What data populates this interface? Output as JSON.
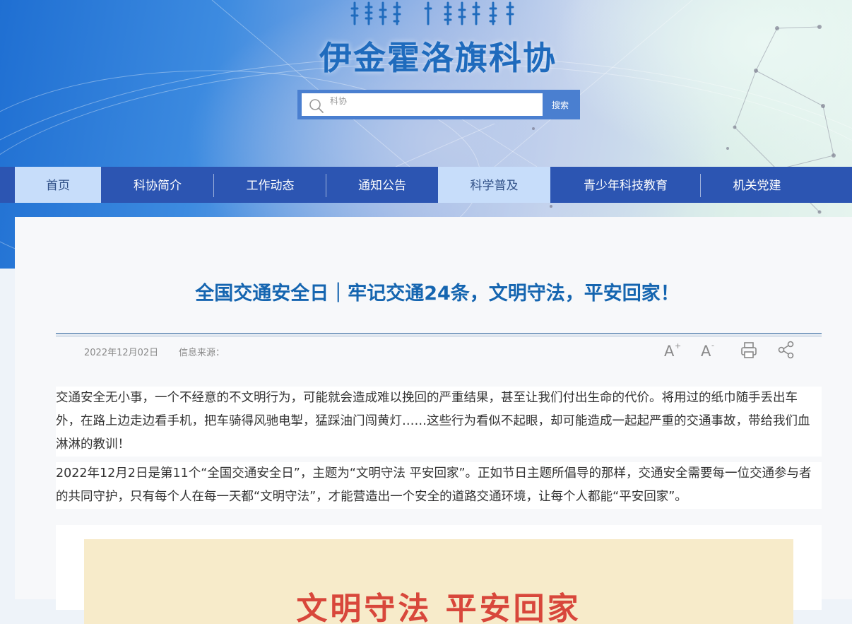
{
  "header": {
    "mongolian_title_decor": "mongolian-script-title",
    "site_title": "伊金霍洛旗科协",
    "search": {
      "placeholder": "科协",
      "button_label": "搜索",
      "icon": "search-icon"
    }
  },
  "nav": {
    "items": [
      {
        "label": "首页",
        "active": true
      },
      {
        "label": "科协简介",
        "active": false
      },
      {
        "label": "工作动态",
        "active": false
      },
      {
        "label": "通知公告",
        "active": false
      },
      {
        "label": "科学普及",
        "active": true
      },
      {
        "label": "青少年科技教育",
        "active": false
      },
      {
        "label": "机关党建",
        "active": false
      }
    ]
  },
  "article": {
    "title": "全国交通安全日｜牢记交通24条，文明守法，平安回家！",
    "date": "2022年12月02日",
    "source_label": "信息来源：",
    "tools": [
      {
        "name": "font-increase-icon",
        "label": "A+"
      },
      {
        "name": "font-decrease-icon",
        "label": "A-"
      },
      {
        "name": "print-icon",
        "label": "print"
      },
      {
        "name": "share-icon",
        "label": "share"
      }
    ],
    "paragraphs": [
      "交通安全无小事，一个不经意的不文明行为，可能就会造成难以挽回的严重结果，甚至让我们付出生命的代价。将用过的纸巾随手丢出车外，在路上边走边看手机，把车骑得风驰电掣，猛踩油门闯黄灯……这些行为看似不起眼，却可能造成一起起严重的交通事故，带给我们血淋淋的教训！",
      "2022年12月2日是第11个“全国交通安全日”，主题为“文明守法 平安回家”。正如节日主题所倡导的那样，交通安全需要每一位交通参与者的共同守护，只有每个人在每一天都“文明守法”，才能营造出一个安全的道路交通环境，让每个人都能“平安回家”。"
    ],
    "poster_text": "文明守法 平安回家"
  },
  "colors": {
    "nav_bg": "#2c55b2",
    "nav_active_bg": "#c7ddfa",
    "title_blue": "#1565b0",
    "site_title_blue": "#1f6bbd",
    "poster_bg": "#f7ebca",
    "poster_red": "#d8473b"
  }
}
